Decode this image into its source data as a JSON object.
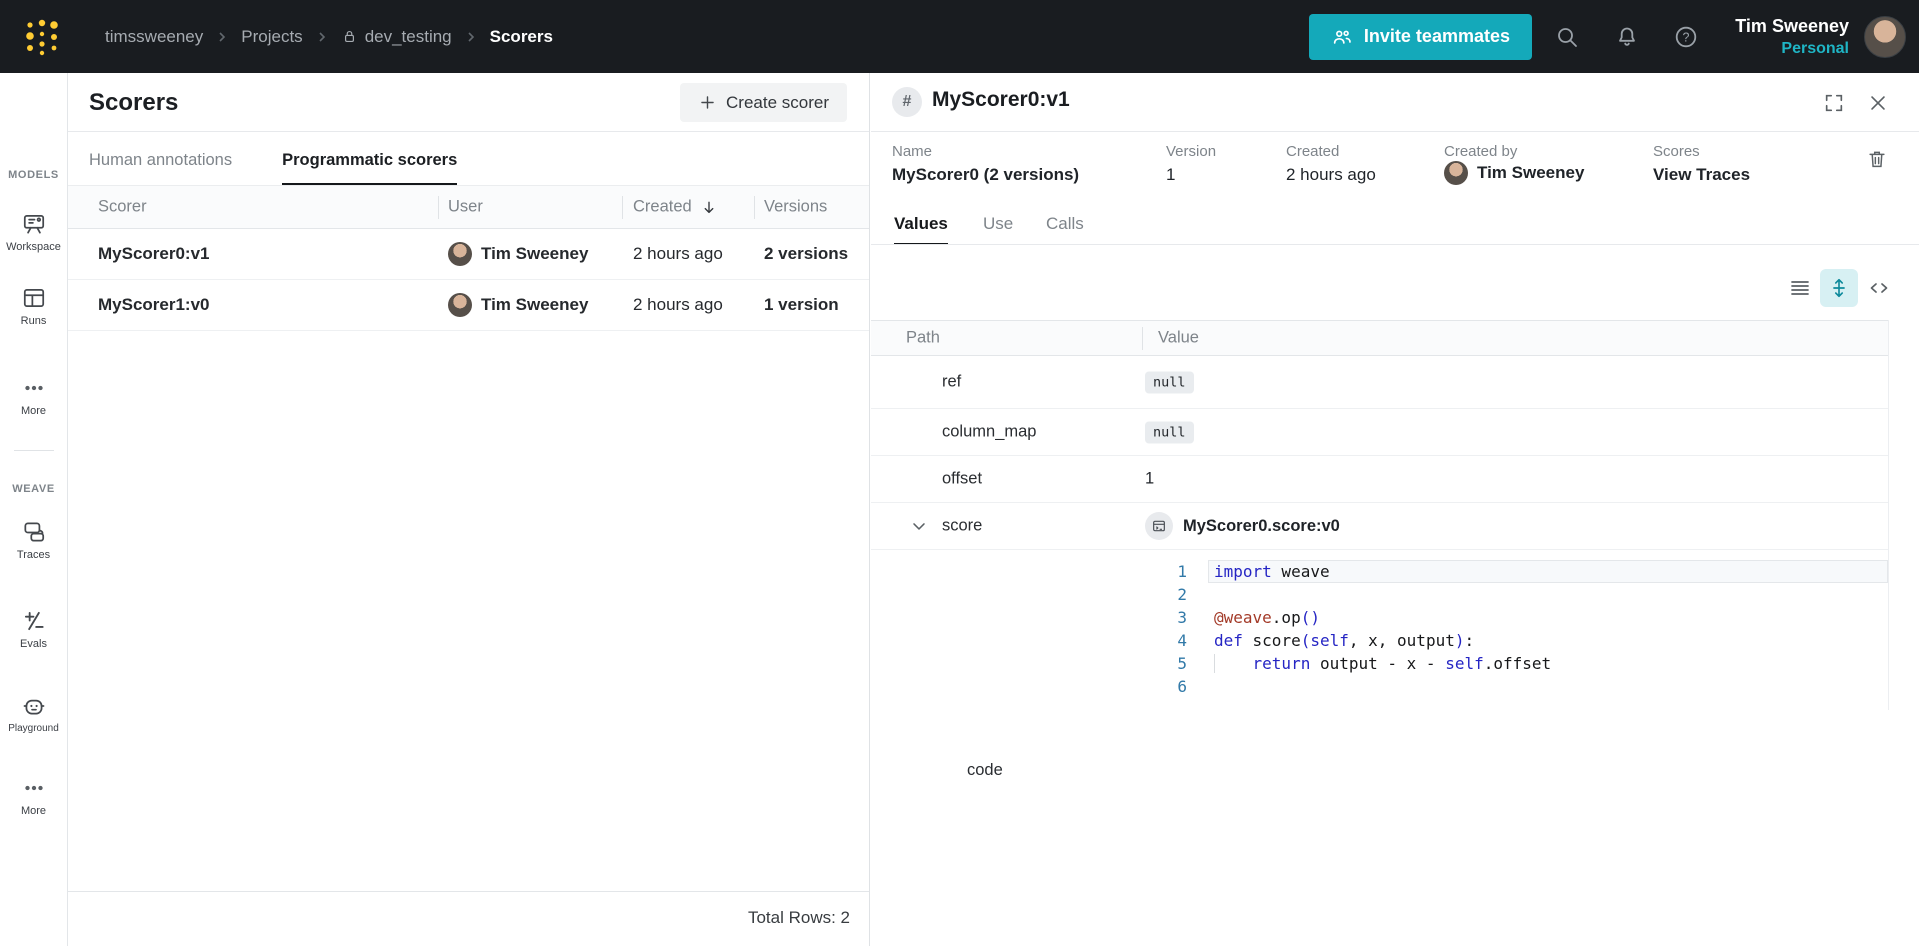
{
  "navbar": {
    "breadcrumbs": [
      "timssweeney",
      "Projects",
      "dev_testing",
      "Scorers"
    ],
    "invite_label": "Invite teammates",
    "user_name": "Tim Sweeney",
    "user_scope": "Personal"
  },
  "sidebar": {
    "sections": [
      {
        "header": "MODELS",
        "items": [
          "Workspace",
          "Runs",
          "More"
        ]
      },
      {
        "header": "WEAVE",
        "items": [
          "Traces",
          "Evals",
          "Playground",
          "More"
        ]
      }
    ]
  },
  "scorers": {
    "title": "Scorers",
    "create_label": "Create scorer",
    "tabs": [
      "Human annotations",
      "Programmatic scorers"
    ],
    "active_tab": "Programmatic scorers",
    "columns": [
      "Scorer",
      "User",
      "Created",
      "Versions"
    ],
    "sorted_by": "Created",
    "rows": [
      {
        "scorer": "MyScorer0:v1",
        "user": "Tim Sweeney",
        "created": "2 hours ago",
        "versions": "2 versions"
      },
      {
        "scorer": "MyScorer1:v0",
        "user": "Tim Sweeney",
        "created": "2 hours ago",
        "versions": "1 version"
      }
    ],
    "footer": "Total Rows: 2"
  },
  "detail": {
    "title": "MyScorer0:v1",
    "fields": [
      {
        "label": "Name",
        "value": "MyScorer0 (2 versions)"
      },
      {
        "label": "Version",
        "value": "1"
      },
      {
        "label": "Created",
        "value": "2 hours ago"
      },
      {
        "label": "Created by",
        "value": "Tim Sweeney"
      },
      {
        "label": "Scores",
        "value": "View Traces"
      }
    ],
    "tabs": [
      "Values",
      "Use",
      "Calls"
    ],
    "active_tab": "Values",
    "grid": {
      "columns": [
        "Path",
        "Value"
      ],
      "rows": [
        {
          "path": "ref",
          "value": "null"
        },
        {
          "path": "column_map",
          "value": "null"
        },
        {
          "path": "offset",
          "value": "1"
        },
        {
          "path": "score",
          "value": "MyScorer0.score:v0"
        }
      ],
      "nested_path_label": "code"
    },
    "code": {
      "lines": [
        {
          "num": "1",
          "active": true,
          "tokens": [
            {
              "t": "import",
              "c": "kw"
            },
            {
              "t": " weave",
              "c": "pl"
            }
          ]
        },
        {
          "num": "2",
          "active": false,
          "tokens": []
        },
        {
          "num": "3",
          "active": false,
          "tokens": [
            {
              "t": "@weave",
              "c": "dec"
            },
            {
              "t": ".op",
              "c": "pl"
            },
            {
              "t": "()",
              "c": "kw"
            }
          ]
        },
        {
          "num": "4",
          "active": false,
          "tokens": [
            {
              "t": "def",
              "c": "kw"
            },
            {
              "t": " score",
              "c": "pl"
            },
            {
              "t": "(",
              "c": "kw"
            },
            {
              "t": "self",
              "c": "kw"
            },
            {
              "t": ", x, output",
              "c": "pl"
            },
            {
              "t": ")",
              "c": "kw"
            },
            {
              "t": ":",
              "c": "pl"
            }
          ]
        },
        {
          "num": "5",
          "active": false,
          "tokens": [
            {
              "t": "    ",
              "c": "ind"
            },
            {
              "t": "return",
              "c": "kw"
            },
            {
              "t": " output - x - ",
              "c": "pl"
            },
            {
              "t": "self",
              "c": "kw"
            },
            {
              "t": ".offset",
              "c": "pl"
            }
          ]
        },
        {
          "num": "6",
          "active": false,
          "tokens": []
        }
      ]
    }
  },
  "colors": {
    "navbar_bg": "#191c20",
    "brand_gold": "#ffcc33",
    "accent_teal": "#14a9ba",
    "teal_text": "#1fb5c5",
    "link_teal": "#0d8a9d",
    "code_keyword": "#2525c4",
    "code_decorator": "#a33a28",
    "code_line_number": "#3179a8"
  }
}
